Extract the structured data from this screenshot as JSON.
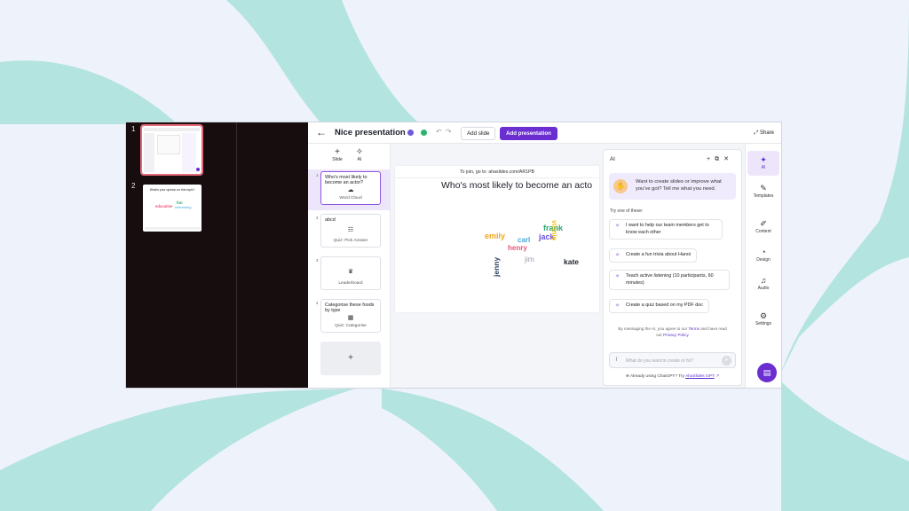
{
  "thumbnails": [
    {
      "num": "1"
    },
    {
      "num": "2",
      "question": "What's your opinion on this topic?",
      "words": [
        "educative",
        "fun",
        "interesting"
      ]
    }
  ],
  "topbar": {
    "back_icon": "arrow-left-icon",
    "title": "Nice presentation",
    "add_slide": "Add slide",
    "add_presentation": "Add presentation",
    "share": "Share"
  },
  "slide_tools": {
    "slide": "Slide",
    "ai": "AI"
  },
  "slides": [
    {
      "num": "1",
      "title": "Who's most likely to become an actor?",
      "type": "Word Cloud"
    },
    {
      "num": "2",
      "title": "abcd",
      "type": "Quiz: Pick Answer"
    },
    {
      "num": "3",
      "title": "",
      "type": "Leaderboard"
    },
    {
      "num": "4",
      "title": "Categorise these foods by type",
      "type": "Quiz: Categorise"
    }
  ],
  "add_slide_plus": "+",
  "canvas": {
    "join_text": "To join, go to: ahaslides.com/AR1PB",
    "question": "Who's most likely to become an acto",
    "words": [
      {
        "text": "emily",
        "color": "#f0a81e"
      },
      {
        "text": "carl",
        "color": "#4aa8d8"
      },
      {
        "text": "henry",
        "color": "#e8577a"
      },
      {
        "text": "frank",
        "color": "#2aa56b"
      },
      {
        "text": "jack",
        "color": "#6a4fd6"
      },
      {
        "text": "vinnie",
        "color": "#f3c01b"
      },
      {
        "text": "jenny",
        "color": "#2b4060"
      },
      {
        "text": "jim",
        "color": "#9aa0ab"
      },
      {
        "text": "kate",
        "color": "#1f2430"
      }
    ]
  },
  "ai_panel": {
    "title": "AI",
    "intro": "Want to create slides or improve what you've got? Tell me what you need.",
    "try_label": "Try one of these:",
    "suggestions": [
      "I want to help our team members get to know each other",
      "Create a fun trivia about Hanoi",
      "Teach active listening (10 participants, 60 minutes)",
      "Create a quiz based on my PDF doc"
    ],
    "disclaimer_pre": "By messaging the AI, you agree to our",
    "terms": "Terms",
    "disclaimer_mid": "and have read our",
    "privacy": "Privacy Policy",
    "input_placeholder": "What do you want to create or fix?",
    "footer_pre": "Already using ChatGPT? Try",
    "footer_link": "AhaSlides GPT"
  },
  "rail": [
    {
      "label": "AI",
      "icon": "sparkle-icon"
    },
    {
      "label": "Templates",
      "icon": "magic-wand-icon"
    },
    {
      "label": "Content",
      "icon": "pencil-icon"
    },
    {
      "label": "Design",
      "icon": "palette-icon"
    },
    {
      "label": "Audio",
      "icon": "music-note-icon"
    },
    {
      "label": "Settings",
      "icon": "gear-icon"
    }
  ],
  "colors": {
    "primary": "#6a2ed1",
    "background": "#eef2fb",
    "swirl": "#b3e4df"
  }
}
